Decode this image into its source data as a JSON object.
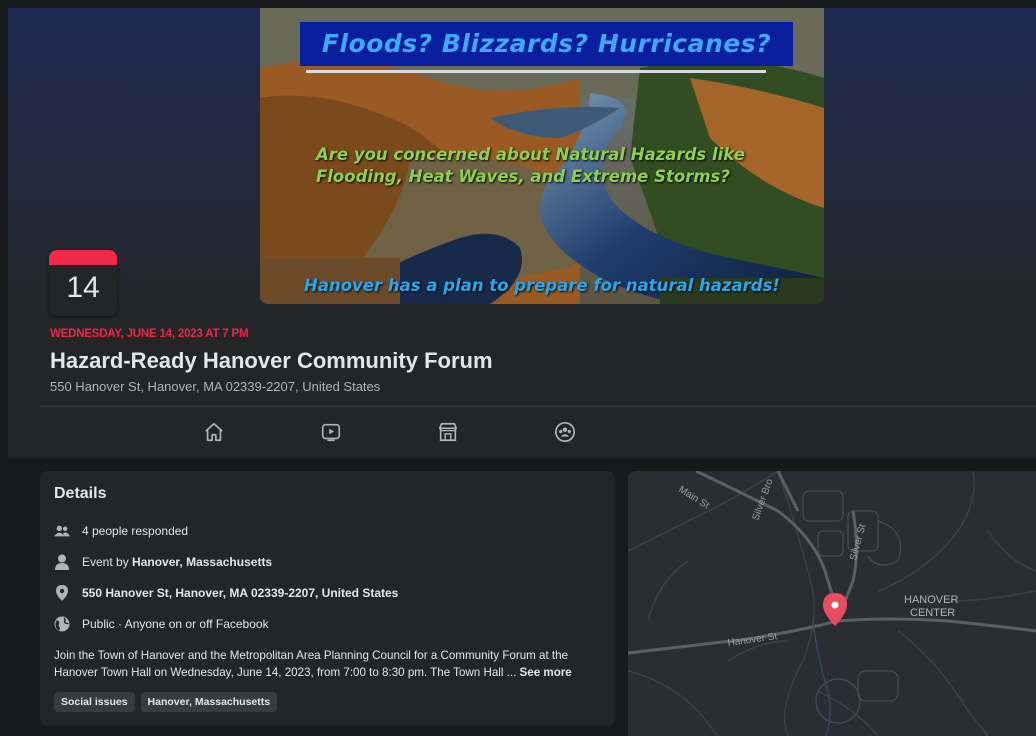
{
  "banner": {
    "title": "Floods?  Blizzards?  Hurricanes?",
    "mid_line1": "Are you concerned about Natural Hazards like",
    "mid_line2": "Flooding, Heat Waves, and Extreme Storms?",
    "bottom": "Hanover has a plan to prepare for natural hazards!"
  },
  "calendar": {
    "day": "14"
  },
  "event": {
    "date": "WEDNESDAY, JUNE 14, 2023 AT 7 PM",
    "title": "Hazard-Ready Hanover Community Forum",
    "address": "550 Hanover St, Hanover, MA 02339-2207, United States"
  },
  "tabs": [
    "home-icon",
    "video-icon",
    "marketplace-icon",
    "groups-icon"
  ],
  "details": {
    "heading": "Details",
    "responded": "4 people responded",
    "event_by_prefix": "Event by ",
    "event_by_name": "Hanover, Massachusetts",
    "location": "550 Hanover St, Hanover, MA 02339-2207, United States",
    "privacy": "Public · Anyone on or off Facebook",
    "description_line1": "Join the Town of Hanover and the Metropolitan Area Planning Council for a Community Forum at the",
    "description_line2": "Hanover Town Hall on Wednesday, June 14, 2023, from 7:00 to 8:30 pm. The Town Hall ... ",
    "see_more": "See more",
    "chips": [
      "Social issues",
      "Hanover, Massachusetts"
    ]
  },
  "map": {
    "labels": {
      "main_st": "Main St",
      "silver_brook": "Silver Bro",
      "silver_st": "Silver St",
      "hanover_st": "Hanover St",
      "center_line1": "HANOVER",
      "center_line2": "CENTER"
    },
    "pin_color": "#ea4c60"
  },
  "colors": {
    "accent_red": "#f02849",
    "banner_blue": "#0a1ea0"
  }
}
